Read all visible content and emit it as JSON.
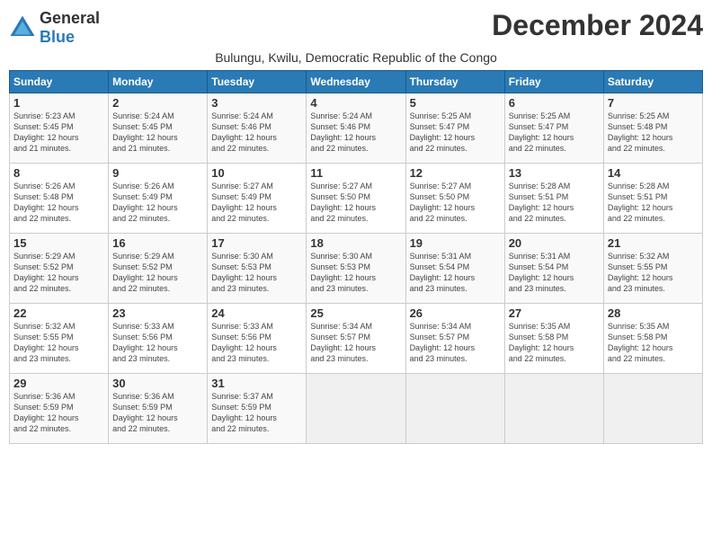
{
  "logo": {
    "general": "General",
    "blue": "Blue"
  },
  "header": {
    "month_year": "December 2024",
    "location": "Bulungu, Kwilu, Democratic Republic of the Congo"
  },
  "calendar": {
    "weekdays": [
      "Sunday",
      "Monday",
      "Tuesday",
      "Wednesday",
      "Thursday",
      "Friday",
      "Saturday"
    ],
    "weeks": [
      [
        {
          "day": "1",
          "info": "Sunrise: 5:23 AM\nSunset: 5:45 PM\nDaylight: 12 hours\nand 21 minutes."
        },
        {
          "day": "2",
          "info": "Sunrise: 5:24 AM\nSunset: 5:45 PM\nDaylight: 12 hours\nand 21 minutes."
        },
        {
          "day": "3",
          "info": "Sunrise: 5:24 AM\nSunset: 5:46 PM\nDaylight: 12 hours\nand 22 minutes."
        },
        {
          "day": "4",
          "info": "Sunrise: 5:24 AM\nSunset: 5:46 PM\nDaylight: 12 hours\nand 22 minutes."
        },
        {
          "day": "5",
          "info": "Sunrise: 5:25 AM\nSunset: 5:47 PM\nDaylight: 12 hours\nand 22 minutes."
        },
        {
          "day": "6",
          "info": "Sunrise: 5:25 AM\nSunset: 5:47 PM\nDaylight: 12 hours\nand 22 minutes."
        },
        {
          "day": "7",
          "info": "Sunrise: 5:25 AM\nSunset: 5:48 PM\nDaylight: 12 hours\nand 22 minutes."
        }
      ],
      [
        {
          "day": "8",
          "info": "Sunrise: 5:26 AM\nSunset: 5:48 PM\nDaylight: 12 hours\nand 22 minutes."
        },
        {
          "day": "9",
          "info": "Sunrise: 5:26 AM\nSunset: 5:49 PM\nDaylight: 12 hours\nand 22 minutes."
        },
        {
          "day": "10",
          "info": "Sunrise: 5:27 AM\nSunset: 5:49 PM\nDaylight: 12 hours\nand 22 minutes."
        },
        {
          "day": "11",
          "info": "Sunrise: 5:27 AM\nSunset: 5:50 PM\nDaylight: 12 hours\nand 22 minutes."
        },
        {
          "day": "12",
          "info": "Sunrise: 5:27 AM\nSunset: 5:50 PM\nDaylight: 12 hours\nand 22 minutes."
        },
        {
          "day": "13",
          "info": "Sunrise: 5:28 AM\nSunset: 5:51 PM\nDaylight: 12 hours\nand 22 minutes."
        },
        {
          "day": "14",
          "info": "Sunrise: 5:28 AM\nSunset: 5:51 PM\nDaylight: 12 hours\nand 22 minutes."
        }
      ],
      [
        {
          "day": "15",
          "info": "Sunrise: 5:29 AM\nSunset: 5:52 PM\nDaylight: 12 hours\nand 22 minutes."
        },
        {
          "day": "16",
          "info": "Sunrise: 5:29 AM\nSunset: 5:52 PM\nDaylight: 12 hours\nand 22 minutes."
        },
        {
          "day": "17",
          "info": "Sunrise: 5:30 AM\nSunset: 5:53 PM\nDaylight: 12 hours\nand 23 minutes."
        },
        {
          "day": "18",
          "info": "Sunrise: 5:30 AM\nSunset: 5:53 PM\nDaylight: 12 hours\nand 23 minutes."
        },
        {
          "day": "19",
          "info": "Sunrise: 5:31 AM\nSunset: 5:54 PM\nDaylight: 12 hours\nand 23 minutes."
        },
        {
          "day": "20",
          "info": "Sunrise: 5:31 AM\nSunset: 5:54 PM\nDaylight: 12 hours\nand 23 minutes."
        },
        {
          "day": "21",
          "info": "Sunrise: 5:32 AM\nSunset: 5:55 PM\nDaylight: 12 hours\nand 23 minutes."
        }
      ],
      [
        {
          "day": "22",
          "info": "Sunrise: 5:32 AM\nSunset: 5:55 PM\nDaylight: 12 hours\nand 23 minutes."
        },
        {
          "day": "23",
          "info": "Sunrise: 5:33 AM\nSunset: 5:56 PM\nDaylight: 12 hours\nand 23 minutes."
        },
        {
          "day": "24",
          "info": "Sunrise: 5:33 AM\nSunset: 5:56 PM\nDaylight: 12 hours\nand 23 minutes."
        },
        {
          "day": "25",
          "info": "Sunrise: 5:34 AM\nSunset: 5:57 PM\nDaylight: 12 hours\nand 23 minutes."
        },
        {
          "day": "26",
          "info": "Sunrise: 5:34 AM\nSunset: 5:57 PM\nDaylight: 12 hours\nand 23 minutes."
        },
        {
          "day": "27",
          "info": "Sunrise: 5:35 AM\nSunset: 5:58 PM\nDaylight: 12 hours\nand 22 minutes."
        },
        {
          "day": "28",
          "info": "Sunrise: 5:35 AM\nSunset: 5:58 PM\nDaylight: 12 hours\nand 22 minutes."
        }
      ],
      [
        {
          "day": "29",
          "info": "Sunrise: 5:36 AM\nSunset: 5:59 PM\nDaylight: 12 hours\nand 22 minutes."
        },
        {
          "day": "30",
          "info": "Sunrise: 5:36 AM\nSunset: 5:59 PM\nDaylight: 12 hours\nand 22 minutes."
        },
        {
          "day": "31",
          "info": "Sunrise: 5:37 AM\nSunset: 5:59 PM\nDaylight: 12 hours\nand 22 minutes."
        },
        {
          "day": "",
          "info": ""
        },
        {
          "day": "",
          "info": ""
        },
        {
          "day": "",
          "info": ""
        },
        {
          "day": "",
          "info": ""
        }
      ]
    ]
  }
}
